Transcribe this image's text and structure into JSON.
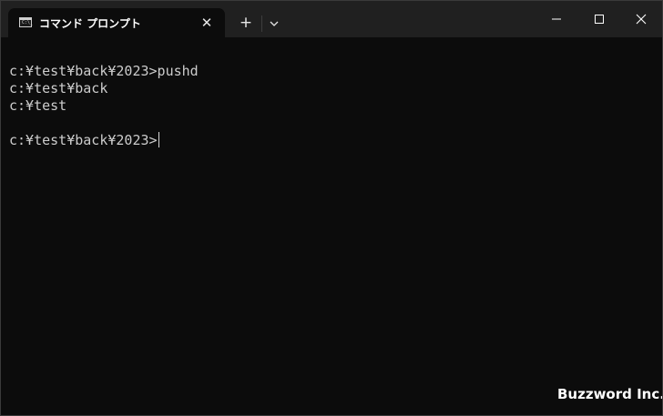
{
  "tab": {
    "title": "コマンド プロンプト",
    "icon": "command-prompt-icon",
    "icon_glyph": "C:\\_"
  },
  "titlebar": {
    "close_tab_glyph": "✕",
    "new_tab_glyph": "+",
    "dropdown_icon": "chevron-down-icon",
    "window_controls": [
      "minimize-icon",
      "maximize-icon",
      "close-icon"
    ]
  },
  "terminal": {
    "lines": [
      "c:¥test¥back¥2023>pushd",
      "c:¥test¥back",
      "c:¥test",
      "",
      "c:¥test¥back¥2023>"
    ]
  },
  "watermark": "Buzzword Inc.",
  "colors": {
    "titlebar": "#202020",
    "terminal_bg": "#0c0c0c",
    "terminal_text": "#cccccc"
  }
}
